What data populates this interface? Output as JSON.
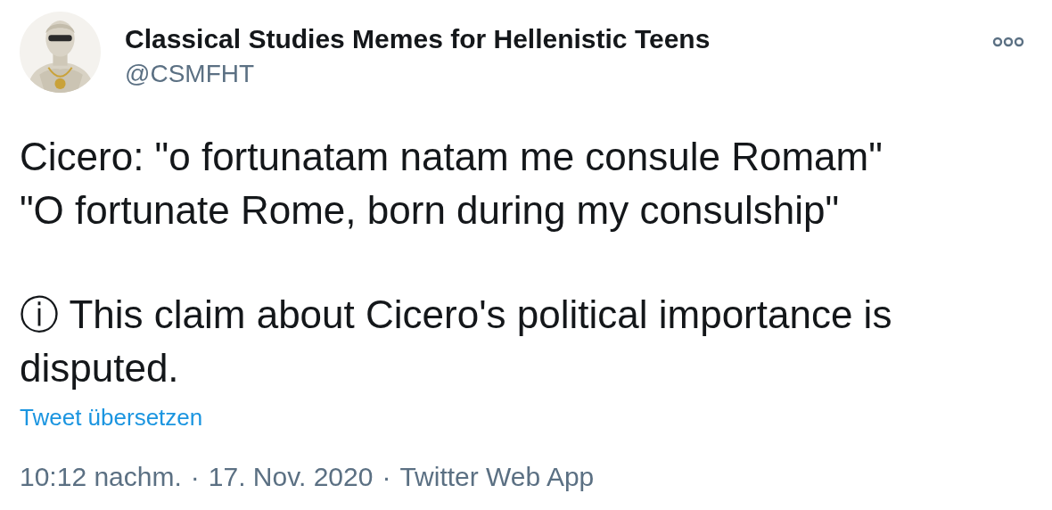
{
  "header": {
    "name": "Classical Studies Memes for Hellenistic Teens",
    "handle": "@CSMFHT"
  },
  "body": [
    "Cicero: \"o fortunatam natam me consule Romam\"\n\"O fortunate Rome, born during my consulship\"",
    "ⓘ This claim about Cicero's political importance is disputed."
  ],
  "translate_link": "Tweet übersetzen",
  "meta": [
    {
      "kind": "link",
      "text": "10:12 nachm."
    },
    {
      "kind": "separator",
      "text": "·"
    },
    {
      "kind": "link",
      "text": "17. Nov. 2020"
    },
    {
      "kind": "separator",
      "text": "·"
    },
    {
      "kind": "link",
      "text": "Twitter Web App"
    }
  ]
}
